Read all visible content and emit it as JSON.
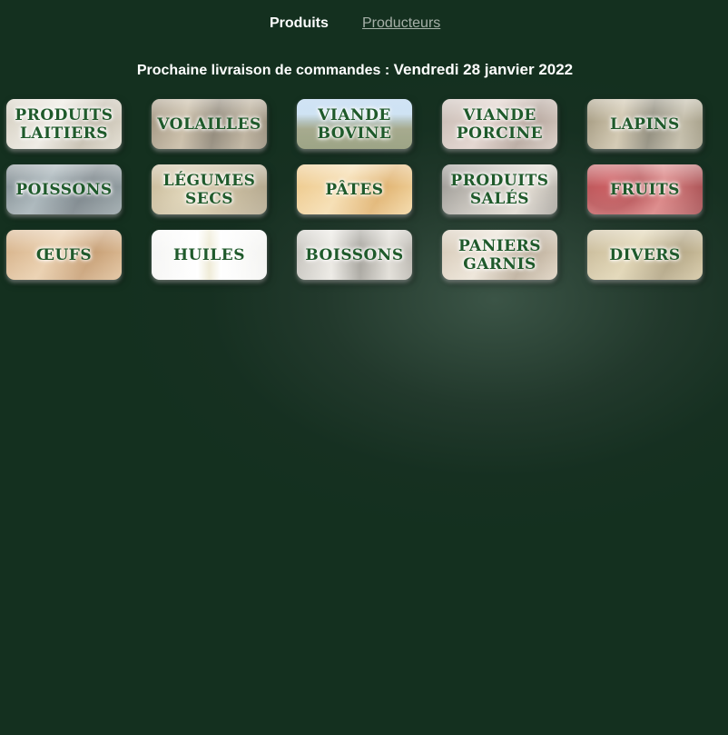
{
  "nav": {
    "products_label": "Produits",
    "producers_label": "Producteurs"
  },
  "delivery": {
    "label": "Prochaine livraison de commandes : ",
    "date": "Vendredi 28 janvier 2022"
  },
  "categories": [
    {
      "label": "PRODUITS\nLAITIERS"
    },
    {
      "label": "VOLAILLES"
    },
    {
      "label": "VIANDE\nBOVINE"
    },
    {
      "label": "VIANDE\nPORCINE"
    },
    {
      "label": "LAPINS"
    },
    {
      "label": "POISSONS"
    },
    {
      "label": "LÉGUMES\nSECS"
    },
    {
      "label": "PÂTES"
    },
    {
      "label": "PRODUITS\nSALÉS"
    },
    {
      "label": "FRUITS"
    },
    {
      "label": "ŒUFS"
    },
    {
      "label": "HUILES"
    },
    {
      "label": "BOISSONS"
    },
    {
      "label": "PANIERS\nGARNIS"
    },
    {
      "label": "DIVERS"
    }
  ],
  "colors": {
    "background": "#14301f",
    "label_green": "#1f5a2b",
    "nav_active": "#ffffff",
    "nav_inactive": "#a6b0a8"
  }
}
